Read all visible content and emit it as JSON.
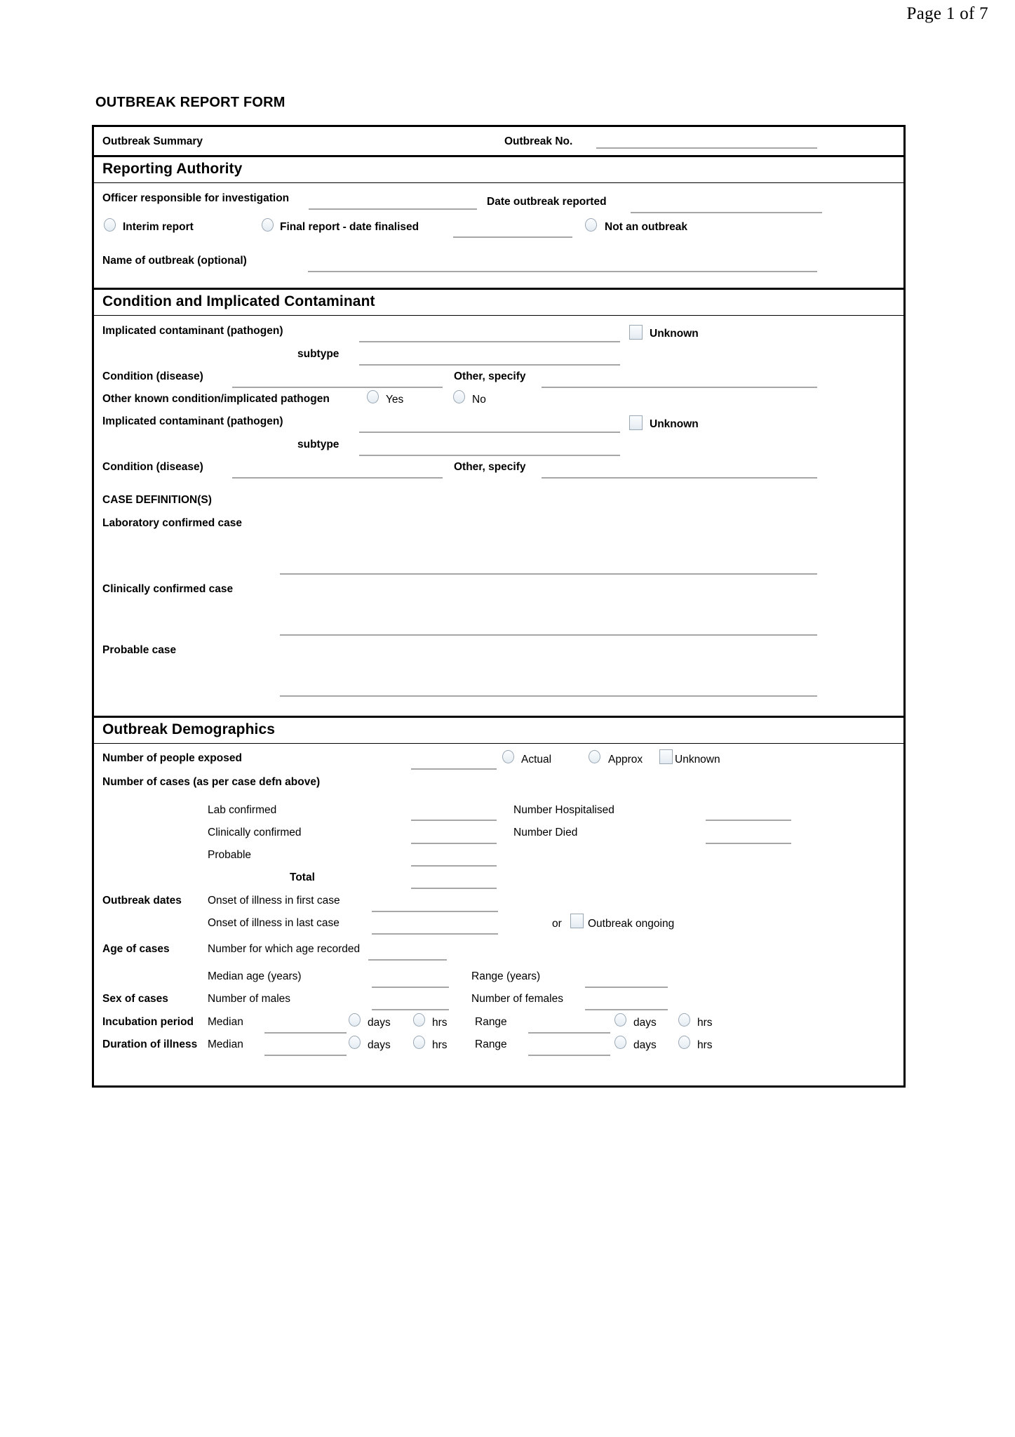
{
  "page_header": "Page 1 of 7",
  "form_title": "OUTBREAK REPORT FORM",
  "summary": {
    "label": "Outbreak Summary",
    "outbreak_no_label": "Outbreak No."
  },
  "reporting_authority": {
    "title": "Reporting Authority",
    "officer_label": "Officer responsible for investigation",
    "date_reported_label": "Date outbreak reported",
    "interim_report_label": "Interim report",
    "final_report_label": "Final report  -  date finalised",
    "not_an_outbreak_label": "Not an outbreak",
    "name_of_outbreak_label": "Name of outbreak (optional)"
  },
  "condition": {
    "title": "Condition and Implicated Contaminant",
    "contaminant_label_1": "Implicated contaminant (pathogen)",
    "subtype_label_1": "subtype",
    "unknown_label_1": "Unknown",
    "condition_label_1": "Condition (disease)",
    "other_specify_label_1": "Other, specify",
    "other_known_label": "Other known condition/implicated pathogen",
    "yes_label": "Yes",
    "no_label": "No",
    "contaminant_label_2": "Implicated contaminant (pathogen)",
    "subtype_label_2": "subtype",
    "unknown_label_2": "Unknown",
    "condition_label_2": "Condition (disease)",
    "other_specify_label_2": "Other, specify",
    "case_definitions_heading": "CASE DEFINITION(S)",
    "lab_confirmed_case_label": "Laboratory confirmed case",
    "clinically_confirmed_case_label": "Clinically confirmed case",
    "probable_case_label": "Probable case"
  },
  "demographics": {
    "title": "Outbreak Demographics",
    "people_exposed_label": "Number of people exposed",
    "actual_label": "Actual",
    "approx_label": "Approx",
    "unknown_label": "Unknown",
    "number_of_cases_label": "Number of cases (as per case defn above)",
    "lab_confirmed_label": "Lab confirmed",
    "clinically_confirmed_label": "Clinically confirmed",
    "probable_label": "Probable",
    "total_label": "Total",
    "number_hospitalised_label": "Number Hospitalised",
    "number_died_label": "Number Died",
    "outbreak_dates_label": "Outbreak dates",
    "onset_first_case_label": "Onset of illness in first case",
    "onset_last_case_label": "Onset of illness in last case",
    "or_label": "or",
    "outbreak_ongoing_label": "Outbreak ongoing",
    "age_of_cases_label": "Age of cases",
    "number_age_recorded_label": "Number for which age recorded",
    "median_age_label": "Median age (years)",
    "range_years_label": "Range (years)",
    "sex_of_cases_label": "Sex of cases",
    "number_of_males_label": "Number of males",
    "number_of_females_label": "Number of females",
    "incubation_period_label": "Incubation period",
    "incubation_median_label": "Median",
    "incubation_range_label": "Range",
    "incubation_median_days_label": "days",
    "incubation_median_hrs_label": "hrs",
    "incubation_range_days_label": "days",
    "incubation_range_hrs_label": "hrs",
    "duration_of_illness_label": "Duration of illness",
    "duration_median_label": "Median",
    "duration_range_label": "Range",
    "duration_median_days_label": "days",
    "duration_median_hrs_label": "hrs",
    "duration_range_days_label": "days",
    "duration_range_hrs_label": "hrs"
  },
  "colors": {
    "rule": "#a6a6a6",
    "control_border": "#9aa8b5",
    "frame": "#000000"
  }
}
